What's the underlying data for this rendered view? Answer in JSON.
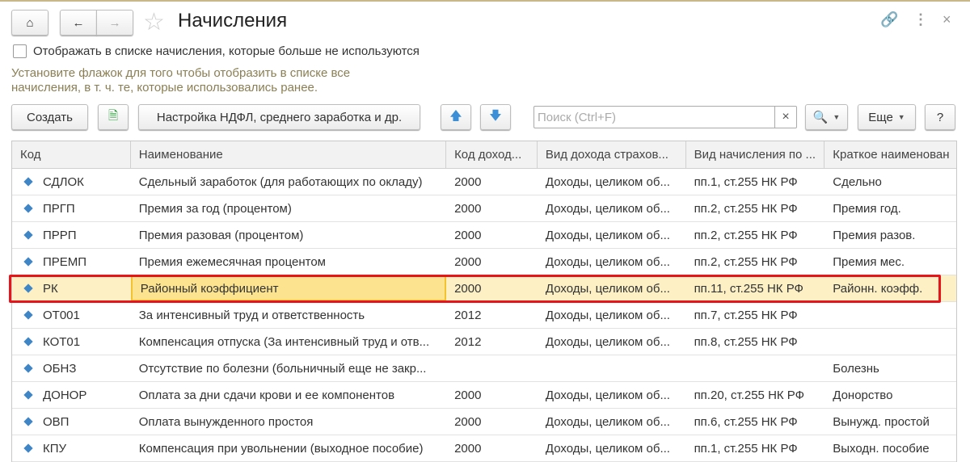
{
  "title": "Начисления",
  "show_unused_label": "Отображать в списке начисления, которые больше не используются",
  "hint": "Установите флажок для того чтобы отобразить в списке все начисления, в т. ч. те, которые использовались ранее.",
  "toolbar": {
    "create": "Создать",
    "settings": "Настройка НДФЛ, среднего заработка и др.",
    "search_placeholder": "Поиск (Ctrl+F)",
    "more": "Еще",
    "help": "?"
  },
  "columns": [
    "Код",
    "Наименование",
    "Код доход...",
    "Вид дохода страхов...",
    "Вид начисления по ...",
    "Краткое наименован"
  ],
  "rows": [
    [
      "СДЛОК",
      "Сдельный заработок (для работающих по окладу)",
      "2000",
      "Доходы, целиком об...",
      "пп.1, ст.255 НК РФ",
      "Сдельно"
    ],
    [
      "ПРГП",
      "Премия за год (процентом)",
      "2000",
      "Доходы, целиком об...",
      "пп.2, ст.255 НК РФ",
      "Премия год."
    ],
    [
      "ПРРП",
      "Премия разовая (процентом)",
      "2000",
      "Доходы, целиком об...",
      "пп.2, ст.255 НК РФ",
      "Премия разов."
    ],
    [
      "ПРЕМП",
      "Премия ежемесячная процентом",
      "2000",
      "Доходы, целиком об...",
      "пп.2, ст.255 НК РФ",
      "Премия мес."
    ],
    [
      "РК",
      "Районный коэффициент",
      "2000",
      "Доходы, целиком об...",
      "пп.11, ст.255 НК РФ",
      "Районн. коэфф."
    ],
    [
      "ОТ001",
      "За интенсивный труд и ответственность",
      "2012",
      "Доходы, целиком об...",
      "пп.7, ст.255 НК РФ",
      ""
    ],
    [
      "КОТ01",
      "Компенсация отпуска (За интенсивный труд и отв...",
      "2012",
      "Доходы, целиком об...",
      "пп.8, ст.255 НК РФ",
      ""
    ],
    [
      "ОБНЗ",
      "Отсутствие по болезни (больничный еще не закр...",
      "",
      "",
      "",
      "Болезнь"
    ],
    [
      "ДОНОР",
      "Оплата за дни сдачи крови и ее компонентов",
      "2000",
      "Доходы, целиком об...",
      "пп.20, ст.255 НК РФ",
      "Донорство"
    ],
    [
      "ОВП",
      "Оплата вынужденного простоя",
      "2000",
      "Доходы, целиком об...",
      "пп.6, ст.255 НК РФ",
      "Вынужд. простой"
    ],
    [
      "КПУ",
      "Компенсация при увольнении (выходное пособие)",
      "2000",
      "Доходы, целиком об...",
      "пп.1, ст.255 НК РФ",
      "Выходн. пособие"
    ]
  ]
}
